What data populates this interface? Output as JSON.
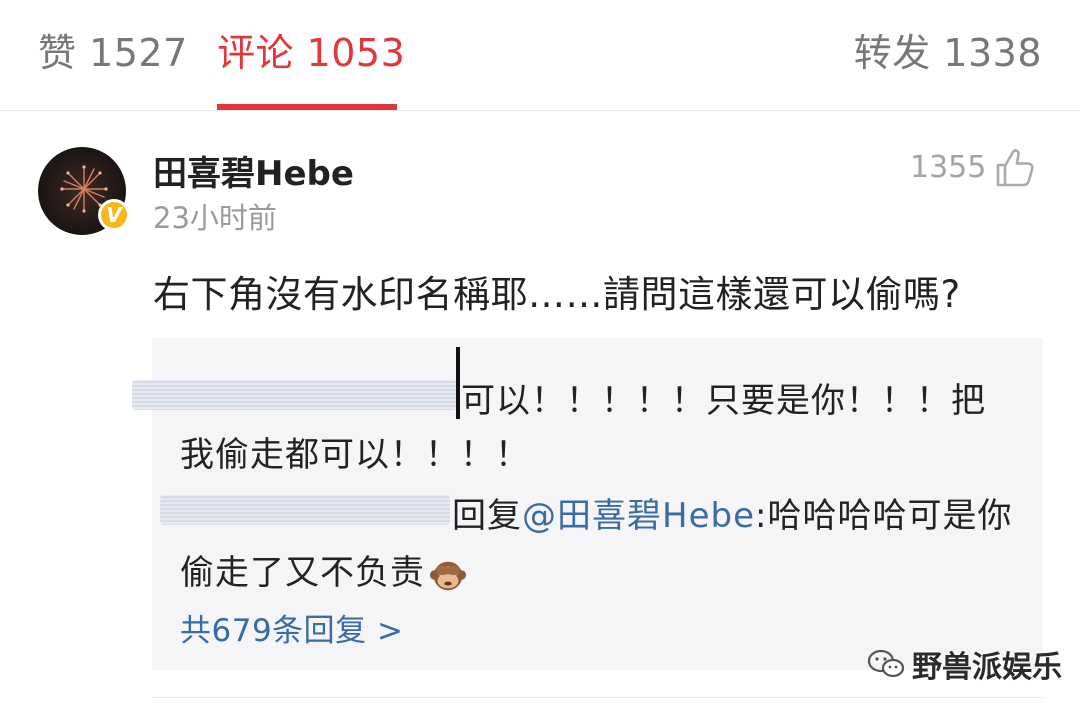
{
  "tabs": {
    "likes": "赞 1527",
    "comments": "评论 1053",
    "reposts": "转发 1338"
  },
  "comment": {
    "username": "田喜碧Hebe",
    "time": "23小时前",
    "like_count": "1355",
    "verified_badge": "V",
    "text": "右下角沒有水印名稱耶……請問這樣還可以偷嗎?"
  },
  "replies": [
    {
      "line1": "可以！！！！！只要是你！！！把",
      "line2": "我偷走都可以！！！！"
    },
    {
      "prefix": "回复",
      "mention": "@田喜碧Hebe",
      "line1_rest": ":哈哈哈哈可是你",
      "line2": "偷走了又不负责",
      "emoji": "see-no-evil-monkey"
    }
  ],
  "total_replies": "共679条回复 >",
  "watermark": "野兽派娱乐",
  "colors": {
    "accent": "#e1363b",
    "link": "#3a6ca4",
    "badge": "#f6b81c",
    "reply_bg": "#f5f5f7"
  }
}
